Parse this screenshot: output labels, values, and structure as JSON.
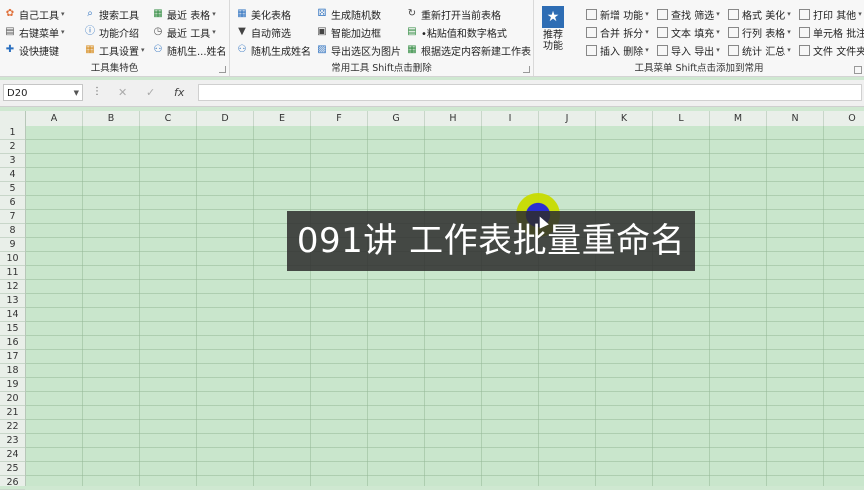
{
  "ribbon": {
    "group1": {
      "label": "工具集特色",
      "items": [
        {
          "label": "自己工具",
          "icon": "flower-icon"
        },
        {
          "label": "右键菜单",
          "icon": "menu-icon"
        },
        {
          "label": "设快捷键",
          "icon": "lightning-icon"
        },
        {
          "label": "搜索工具",
          "icon": "search-icon"
        },
        {
          "label": "功能介绍",
          "icon": "info-icon"
        },
        {
          "label": "工具设置",
          "icon": "settings-icon"
        },
        {
          "label": "最近",
          "sub": "表格",
          "icon": "table-icon"
        },
        {
          "label": "最近",
          "sub": "工具",
          "icon": "clock-icon"
        },
        {
          "label": "随机生...姓名",
          "icon": "users-icon"
        }
      ]
    },
    "group2": {
      "label": "常用工具 Shift点击删除",
      "items": [
        {
          "label": "美化表格",
          "icon": "grid-icon"
        },
        {
          "label": "自动筛选",
          "icon": "filter-icon"
        },
        {
          "label": "随机生成姓名",
          "icon": "users-icon"
        },
        {
          "label": "生成随机数",
          "icon": "dice-icon"
        },
        {
          "label": "智能加边框",
          "icon": "border-icon"
        },
        {
          "label": "导出选区为图片",
          "icon": "image-icon"
        },
        {
          "label": "重新打开当前表格",
          "icon": "refresh-icon"
        },
        {
          "label": "•粘贴值和数字格式",
          "icon": "paste-icon"
        },
        {
          "label": "根据选定内容新建工作表",
          "icon": "new-sheet-icon"
        }
      ]
    },
    "group3": {
      "label": "工具菜单 Shift点击添加到常用",
      "recommend": "推荐\n功能",
      "items": [
        {
          "a": "新增",
          "b": "功能"
        },
        {
          "a": "合并",
          "b": "拆分"
        },
        {
          "a": "插入",
          "b": "删除"
        },
        {
          "a": "查找",
          "b": "筛选"
        },
        {
          "a": "文本",
          "b": "填充"
        },
        {
          "a": "导入",
          "b": "导出"
        },
        {
          "a": "格式",
          "b": "美化"
        },
        {
          "a": "行列",
          "b": "表格"
        },
        {
          "a": "统计",
          "b": "汇总"
        },
        {
          "a": "打印",
          "b": "其他"
        },
        {
          "a": "单元格",
          "b": "批注"
        },
        {
          "a": "文件",
          "b": "文件夹"
        }
      ]
    }
  },
  "formula_bar": {
    "name_box": "D20",
    "cancel_icon": "✕",
    "enter_icon": "✓",
    "fx_label": "fx",
    "value": ""
  },
  "sheet": {
    "columns": [
      "A",
      "B",
      "C",
      "D",
      "E",
      "F",
      "G",
      "H",
      "I",
      "J",
      "K",
      "L",
      "M",
      "N",
      "O"
    ],
    "rows": [
      "1",
      "2",
      "3",
      "4",
      "5",
      "6",
      "7",
      "8",
      "9",
      "10",
      "11",
      "12",
      "13",
      "14",
      "15",
      "16",
      "17",
      "18",
      "19",
      "20",
      "21",
      "22",
      "23",
      "24",
      "25",
      "26"
    ]
  },
  "overlay": {
    "title": "091讲 工作表批量重命名"
  },
  "colors": {
    "sheet_bg": "#c9e6cc",
    "overlay_bg": "#2d2d2d",
    "highlight": "#c8dc00",
    "cursor_core": "#2b2ed0"
  }
}
